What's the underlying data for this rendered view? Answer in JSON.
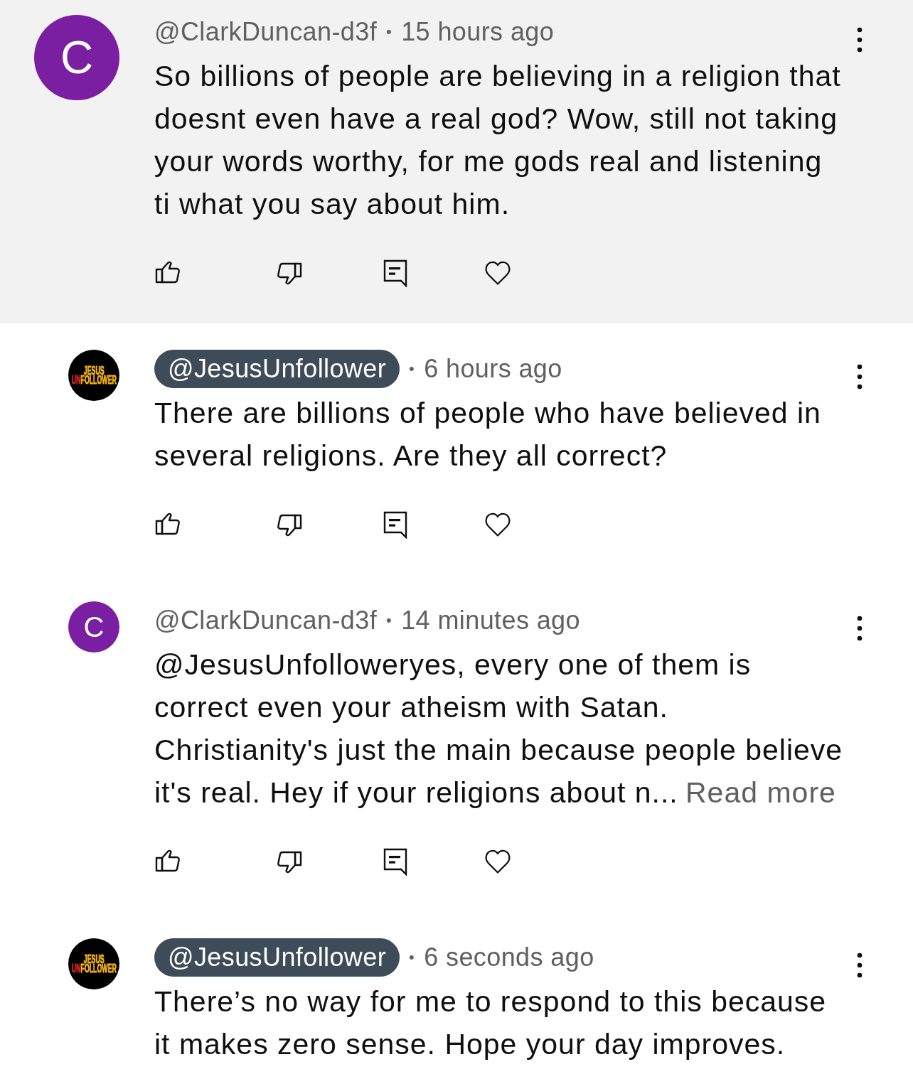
{
  "comments": [
    {
      "kind": "comment",
      "highlighted": true,
      "avatar": {
        "kind": "letter",
        "letter": "C",
        "color": "#7b1fa2"
      },
      "author": "@ClarkDuncan-d3f",
      "creator": false,
      "separator": "•",
      "time": "15 hours ago",
      "text": "So billions of people are believing in a religion that doesnt even have a real god? Wow, still not taking your words worthy, for me gods real and listening ti what you say about him.",
      "actions": [
        {
          "kind": "like"
        },
        {
          "kind": "dislike"
        },
        {
          "kind": "reply"
        },
        {
          "kind": "heart"
        }
      ]
    },
    {
      "kind": "reply",
      "highlighted": false,
      "avatar": {
        "kind": "logo",
        "lines": [
          [
            {
              "text": "JESUS",
              "kind": "main"
            }
          ],
          [
            {
              "text": "UN",
              "kind": "accent"
            },
            {
              "text": "FOLLOWER",
              "kind": "main"
            }
          ]
        ]
      },
      "author": "@JesusUnfollower",
      "creator": true,
      "separator": "•",
      "time": "6 hours ago",
      "text": "There are billions of people who have believed in several religions. Are they all correct?",
      "actions": [
        {
          "kind": "like"
        },
        {
          "kind": "dislike"
        },
        {
          "kind": "reply"
        },
        {
          "kind": "heart"
        }
      ]
    },
    {
      "kind": "reply",
      "highlighted": false,
      "avatar": {
        "kind": "letter",
        "letter": "C",
        "color": "#7b1fa2"
      },
      "author": "@ClarkDuncan-d3f",
      "creator": false,
      "separator": "•",
      "time": "14 minutes ago",
      "text": "@JesusUnfolloweryes, every one of them is correct even your atheism with Satan. Christianity's just the main because people believe it's real. Hey if your religions about n...",
      "read_more": "Read more",
      "actions": [
        {
          "kind": "like"
        },
        {
          "kind": "dislike"
        },
        {
          "kind": "reply"
        },
        {
          "kind": "heart"
        }
      ]
    },
    {
      "kind": "reply",
      "highlighted": false,
      "avatar": {
        "kind": "logo",
        "lines": [
          [
            {
              "text": "JESUS",
              "kind": "main"
            }
          ],
          [
            {
              "text": "UN",
              "kind": "accent"
            },
            {
              "text": "FOLLOWER",
              "kind": "main"
            }
          ]
        ]
      },
      "author": "@JesusUnfollower",
      "creator": true,
      "separator": "•",
      "time": "6 seconds ago",
      "text": "There’s no way for me to respond to this because it makes zero sense. Hope your day improves."
    }
  ]
}
